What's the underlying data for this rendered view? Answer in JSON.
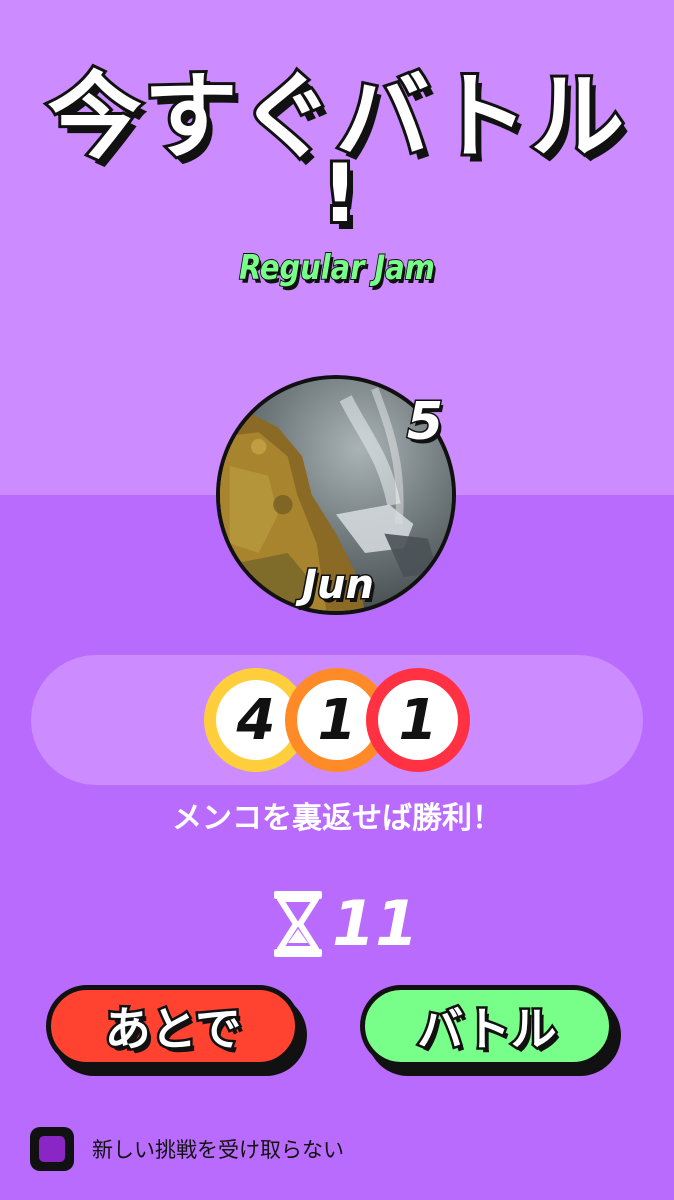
{
  "header": {
    "title_main": "今すぐバトル",
    "title_bang": "!",
    "mode": "Regular Jam"
  },
  "player": {
    "name": "Jun",
    "rank": "5"
  },
  "scores": [
    {
      "value": "4",
      "color": "#ffce3b"
    },
    {
      "value": "1",
      "color": "#ff8a27"
    },
    {
      "value": "1",
      "color": "#ff3143"
    }
  ],
  "hint": "メンコを裏返せば勝利！",
  "timer": {
    "icon": "hourglass-icon",
    "value": "11"
  },
  "buttons": {
    "later_label": "あとで",
    "battle_label": "バトル"
  },
  "option": {
    "label": "新しい挑戦を受け取らない",
    "checked": true
  },
  "colors": {
    "background_top": "#cc8bff",
    "background_bottom": "#b96bfe",
    "later_button": "#ff4330",
    "battle_button": "#78ff8a",
    "mode_text": "#78ff8a"
  }
}
